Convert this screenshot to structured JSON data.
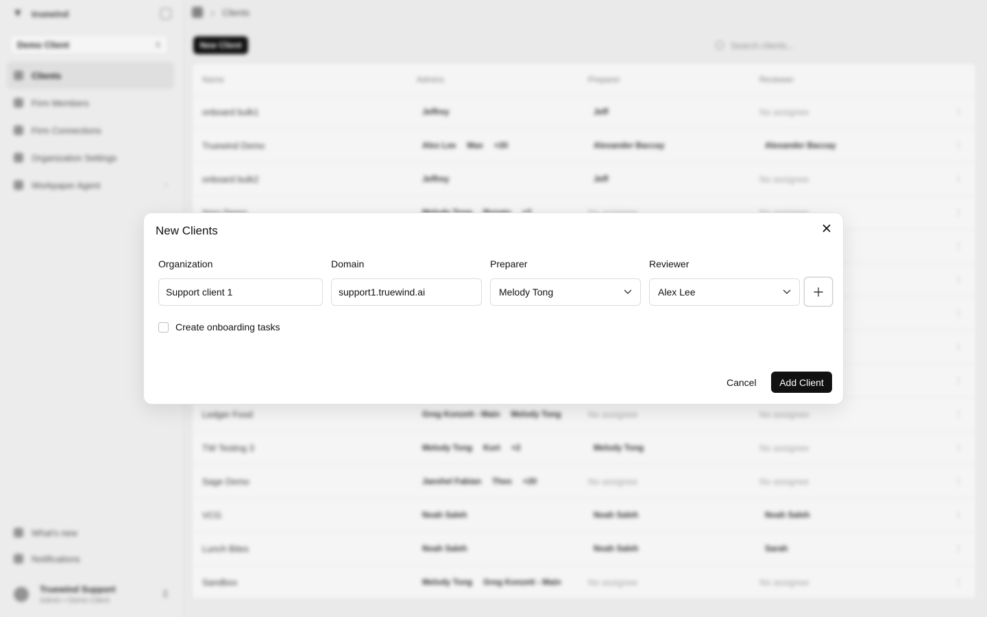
{
  "background": {
    "sidebar": {
      "brand": "truewind",
      "client_switcher": "Demo Client",
      "nav": [
        {
          "label": "Clients",
          "active": true
        },
        {
          "label": "Firm Members"
        },
        {
          "label": "Firm Connections"
        },
        {
          "label": "Organization Settings"
        },
        {
          "label": "Workpaper Agent"
        }
      ],
      "footer": [
        {
          "label": "What's new"
        },
        {
          "label": "Notifications"
        }
      ],
      "user": {
        "name": "Truewind Support",
        "role": "Admin • Demo Client"
      }
    },
    "breadcrumb": {
      "current": "Clients"
    },
    "new_button": "New Client",
    "search_placeholder": "Search clients...",
    "table": {
      "headers": [
        "Name",
        "Admins",
        "Preparer",
        "Reviewer"
      ],
      "rows": [
        {
          "name": "onboard bulk1",
          "admins": [
            "Jeffrey"
          ],
          "preparer": "Jeff",
          "reviewer": "No assignee"
        },
        {
          "name": "Truewind Demo",
          "admins": [
            "Alex Lee",
            "Max",
            "+20"
          ],
          "preparer": "Alexander Baccay",
          "reviewer": "Alexander Baccay"
        },
        {
          "name": "onboard bulk2",
          "admins": [
            "Jeffrey"
          ],
          "preparer": "Jeff",
          "reviewer": "No assignee"
        },
        {
          "name": "Xero Demo",
          "admins": [
            "Melody Tong",
            "Renato",
            "+2"
          ],
          "preparer": "No assignee",
          "reviewer": "No assignee"
        },
        {
          "name": "",
          "admins": [],
          "preparer": "",
          "reviewer": ""
        },
        {
          "name": "",
          "admins": [],
          "preparer": "",
          "reviewer": ""
        },
        {
          "name": "",
          "admins": [],
          "preparer": "",
          "reviewer": ""
        },
        {
          "name": "",
          "admins": [],
          "preparer": "",
          "reviewer": ""
        },
        {
          "name": "",
          "admins": [],
          "preparer": "",
          "reviewer": ""
        },
        {
          "name": "Ledger Food",
          "admins": [
            "Greg Konzett - Main",
            "Melody Tong"
          ],
          "preparer": "No assignee",
          "reviewer": "No assignee"
        },
        {
          "name": "TW Testing 3",
          "admins": [
            "Melody Tong",
            "Kurt",
            "+2"
          ],
          "preparer": "Melody Tong",
          "reviewer": "No assignee"
        },
        {
          "name": "Sage Demo",
          "admins": [
            "Jaeshel Fabian",
            "Theo",
            "+20"
          ],
          "preparer": "No assignee",
          "reviewer": "No assignee"
        },
        {
          "name": "VCG",
          "admins": [
            "Noah Saleh"
          ],
          "preparer": "Noah Saleh",
          "reviewer": "Noah Saleh"
        },
        {
          "name": "Lunch Bites",
          "admins": [
            "Noah Saleh"
          ],
          "preparer": "Noah Saleh",
          "reviewer": "Sarah"
        },
        {
          "name": "Sandbox",
          "admins": [
            "Melody Tong",
            "Greg Konzett - Main"
          ],
          "preparer": "No assignee",
          "reviewer": "No assignee"
        }
      ]
    }
  },
  "dialog": {
    "title": "New Clients",
    "labels": {
      "organization": "Organization",
      "domain": "Domain",
      "preparer": "Preparer",
      "reviewer": "Reviewer"
    },
    "values": {
      "organization": "Support client 1",
      "domain": "support1.truewind.ai",
      "preparer": "Melody Tong",
      "reviewer": "Alex Lee"
    },
    "checkbox_label": "Create onboarding tasks",
    "checkbox_checked": false,
    "cancel": "Cancel",
    "submit": "Add Client"
  }
}
